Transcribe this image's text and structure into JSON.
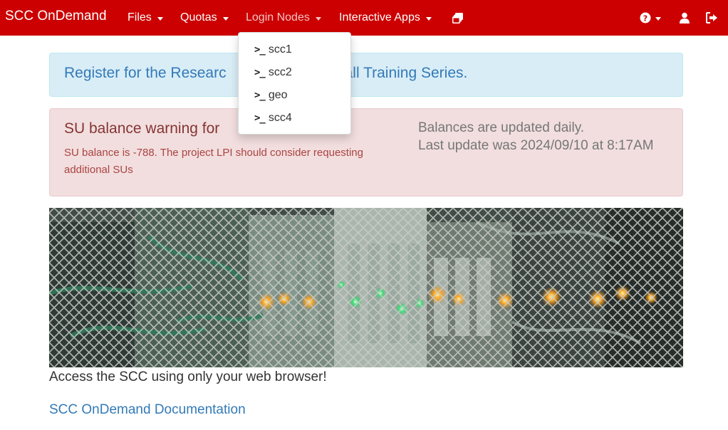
{
  "navbar": {
    "brand": "SCC OnDemand",
    "menus": [
      {
        "label": "Files"
      },
      {
        "label": "Quotas"
      },
      {
        "label": "Login Nodes"
      },
      {
        "label": "Interactive Apps"
      }
    ],
    "icons": [
      "sessions-icon",
      "help-icon",
      "user-icon",
      "logout-icon"
    ],
    "bg_color": "#cc0000"
  },
  "login_nodes_dropdown": {
    "items": [
      {
        "prompt": ">_",
        "label": "scc1"
      },
      {
        "prompt": ">_",
        "label": "scc2"
      },
      {
        "prompt": ">_",
        "label": "geo"
      },
      {
        "prompt": ">_",
        "label": "scc4"
      }
    ]
  },
  "alert_info": {
    "text_left": "Register for the Researc",
    "text_right": "all Training Series."
  },
  "alert_danger": {
    "title": "SU balance warning for",
    "message": "SU balance is -788. The project LPI should consider requesting additional SUs",
    "balances_line1": "Balances are updated daily.",
    "balances_line2": "Last update was 2024/09/10 at 8:17AM"
  },
  "main": {
    "tagline": "Access the SCC using only your web browser!",
    "doc_link": "SCC OnDemand Documentation"
  }
}
